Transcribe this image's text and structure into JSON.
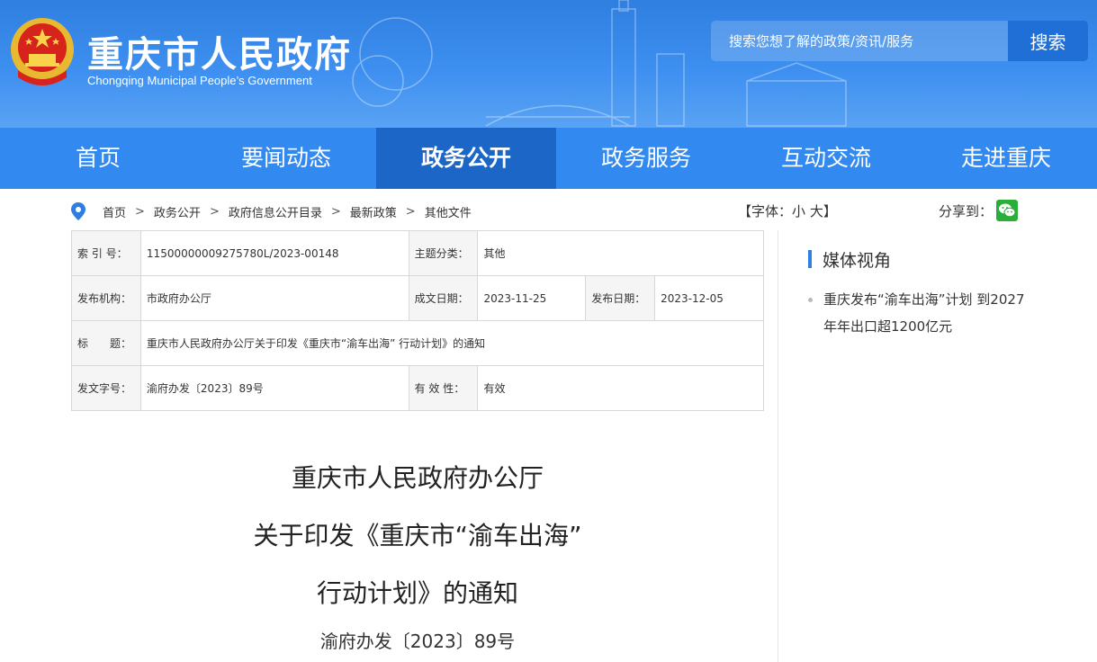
{
  "header": {
    "title": "重庆市人民政府",
    "subtitle": "Chongqing Municipal People’s Government",
    "search_placeholder": "搜索您想了解的政策/资讯/服务",
    "search_button": "搜索"
  },
  "nav": [
    {
      "label": "首页"
    },
    {
      "label": "要闻动态"
    },
    {
      "label": "政务公开"
    },
    {
      "label": "政务服务"
    },
    {
      "label": "互动交流"
    },
    {
      "label": "走进重庆"
    }
  ],
  "breadcrumb": [
    "首页",
    "政务公开",
    "政府信息公开目录",
    "最新政策",
    "其他文件"
  ],
  "font_size": {
    "prefix": "【字体：",
    "small": "小",
    "large": "大",
    "suffix": "】"
  },
  "share_label": "分享到：",
  "info_table": {
    "index_key": "索 引 号：",
    "index_value": "11500000009275780L/2023-00148",
    "topic_key": "主题分类：",
    "topic_value": "其他",
    "issuer_key": "发布机构：",
    "issuer_value": "市政府办公厅",
    "written_key": "成文日期：",
    "written_value": "2023-11-25",
    "published_key": "发布日期：",
    "published_value": "2023-12-05",
    "title_key": "标　　题：",
    "title_value": "重庆市人民政府办公厅关于印发《重庆市“渝车出海” 行动计划》的通知",
    "docno_key": "发文字号：",
    "docno_value": "渝府办发〔2023〕89号",
    "validity_key": "有 效 性：",
    "validity_value": "有效"
  },
  "sidebar": {
    "heading": "媒体视角",
    "items": [
      {
        "text": "重庆发布“渝车出海”计划 到2027年年出口超1200亿元"
      }
    ]
  },
  "document": {
    "title_line1": "重庆市人民政府办公厅",
    "title_line2": "关于印发《重庆市“渝车出海”",
    "title_line3": "行动计划》的通知",
    "number": "渝府办发〔2023〕89号"
  },
  "colors": {
    "header_blue": "#3289f0",
    "active_nav": "#1b66c7",
    "accent": "#2f7fe0"
  }
}
